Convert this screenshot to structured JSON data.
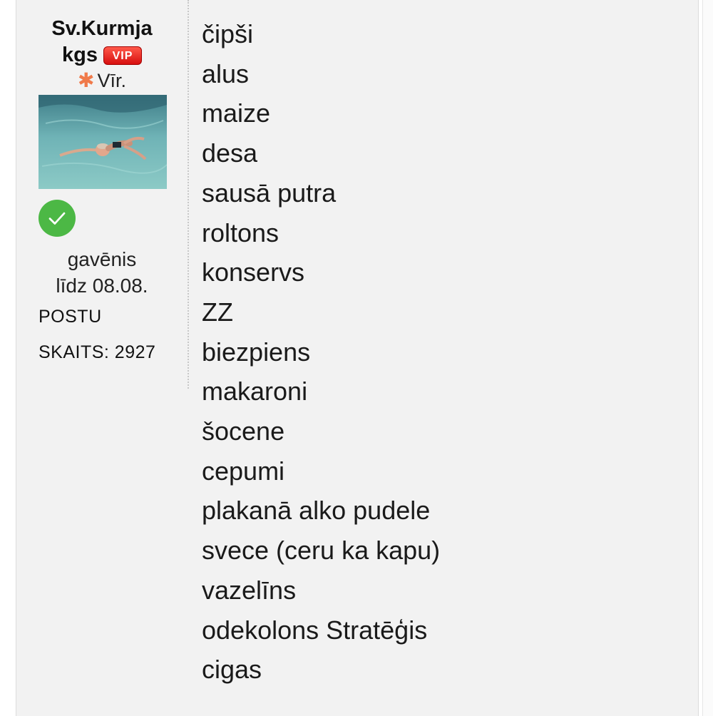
{
  "user": {
    "name_line1": "Sv.Kurmja",
    "name_line2": "kgs",
    "vip_label": "VIP",
    "gender": "Vīr.",
    "status_line1": "gavēnis",
    "status_line2": "līdz 08.08.",
    "posts_label": "POSTU",
    "posts_count": "SKAITS: 2927",
    "gender_icon": "asterisk-icon",
    "verified_icon": "checkmark-icon",
    "verified_color": "#4cb845",
    "vip_color": "#e01e1e"
  },
  "post": {
    "items": [
      "čipši",
      "alus",
      "maize",
      "desa",
      "sausā putra",
      "roltons",
      "konservs",
      "ZZ",
      "biezpiens",
      "makaroni",
      "šocene",
      "cepumi",
      "plakanā alko pudele",
      "svece (ceru ka kapu)",
      "vazelīns",
      "odekolons Stratēģis",
      "cigas"
    ]
  }
}
